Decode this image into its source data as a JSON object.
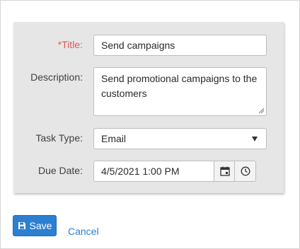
{
  "form": {
    "title_label": "*Title:",
    "title_value": "Send campaigns",
    "description_label": "Description:",
    "description_value": "Send promotional campaigns to the customers",
    "task_type_label": "Task Type:",
    "task_type_value": "Email",
    "due_date_label": "Due Date:",
    "due_date_value": "4/5/2021 1:00 PM"
  },
  "actions": {
    "save_label": "Save",
    "cancel_label": "Cancel"
  },
  "icons": {
    "save": "floppy-disk-icon",
    "calendar": "calendar-icon",
    "clock": "clock-icon",
    "dropdown": "chevron-down-icon"
  },
  "colors": {
    "required_label": "#e05a5a",
    "primary": "#2d7fd0",
    "panel_bg": "#e6e6e6"
  }
}
